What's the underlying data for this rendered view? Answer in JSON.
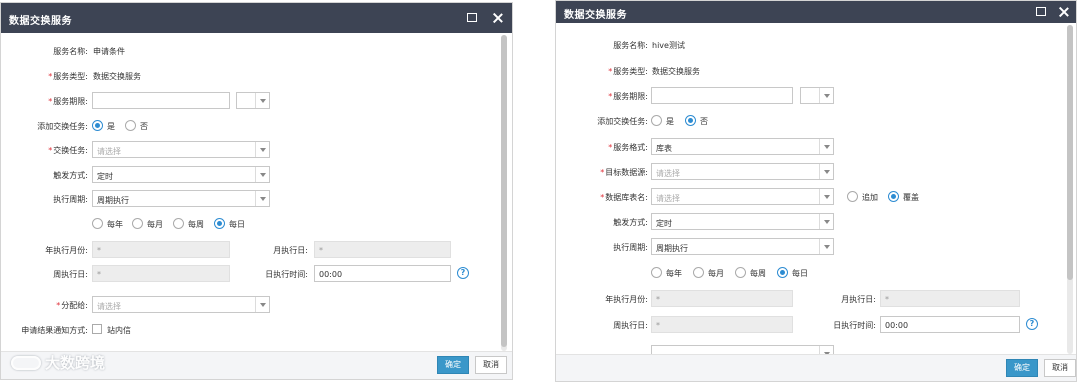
{
  "watermark": {
    "text": "大数跨境"
  },
  "left": {
    "title": "数据交换服务",
    "service_name_label": "服务名称:",
    "service_name_value": "申请条件",
    "service_type_label": "服务类型:",
    "service_type_value": "数据交换服务",
    "service_period_label": "服务期限:",
    "add_task_label": "添加交换任务:",
    "add_task_yes": "是",
    "add_task_no": "否",
    "exchange_task_label": "交换任务:",
    "exchange_task_placeholder": "请选择",
    "trigger_label": "触发方式:",
    "trigger_value": "定时",
    "period_label": "执行周期:",
    "period_value": "周期执行",
    "freq_yearly": "每年",
    "freq_monthly": "每月",
    "freq_weekly": "每周",
    "freq_daily": "每日",
    "year_month_label": "年执行月份:",
    "year_month_value": "*",
    "month_day_label": "月执行日:",
    "month_day_value": "*",
    "week_day_label": "周执行日:",
    "week_day_value": "*",
    "day_time_label": "日执行时间:",
    "day_time_value": "00:00",
    "assign_label": "分配给:",
    "assign_placeholder": "请选择",
    "notify_label": "申请结果通知方式:",
    "notify_option": "站内信",
    "ok_label": "确定",
    "cancel_label": "取消"
  },
  "right": {
    "title": "数据交换服务",
    "service_name_label": "服务名称:",
    "service_name_value": "hive测试",
    "service_type_label": "服务类型:",
    "service_type_value": "数据交换服务",
    "service_period_label": "服务期限:",
    "add_task_label": "添加交换任务:",
    "add_task_yes": "是",
    "add_task_no": "否",
    "format_label": "服务格式:",
    "format_value": "库表",
    "target_ds_label": "目标数据源:",
    "target_ds_placeholder": "请选择",
    "table_name_label": "数据库表名:",
    "table_name_placeholder": "请选择",
    "mode_append": "追加",
    "mode_overwrite": "覆盖",
    "trigger_label": "触发方式:",
    "trigger_value": "定时",
    "period_label": "执行周期:",
    "period_value": "周期执行",
    "freq_yearly": "每年",
    "freq_monthly": "每月",
    "freq_weekly": "每周",
    "freq_daily": "每日",
    "year_month_label": "年执行月份:",
    "year_month_value": "*",
    "month_day_label": "月执行日:",
    "month_day_value": "*",
    "week_day_label": "周执行日:",
    "week_day_value": "*",
    "day_time_label": "日执行时间:",
    "day_time_value": "00:00",
    "ok_label": "确定",
    "cancel_label": "取消"
  }
}
